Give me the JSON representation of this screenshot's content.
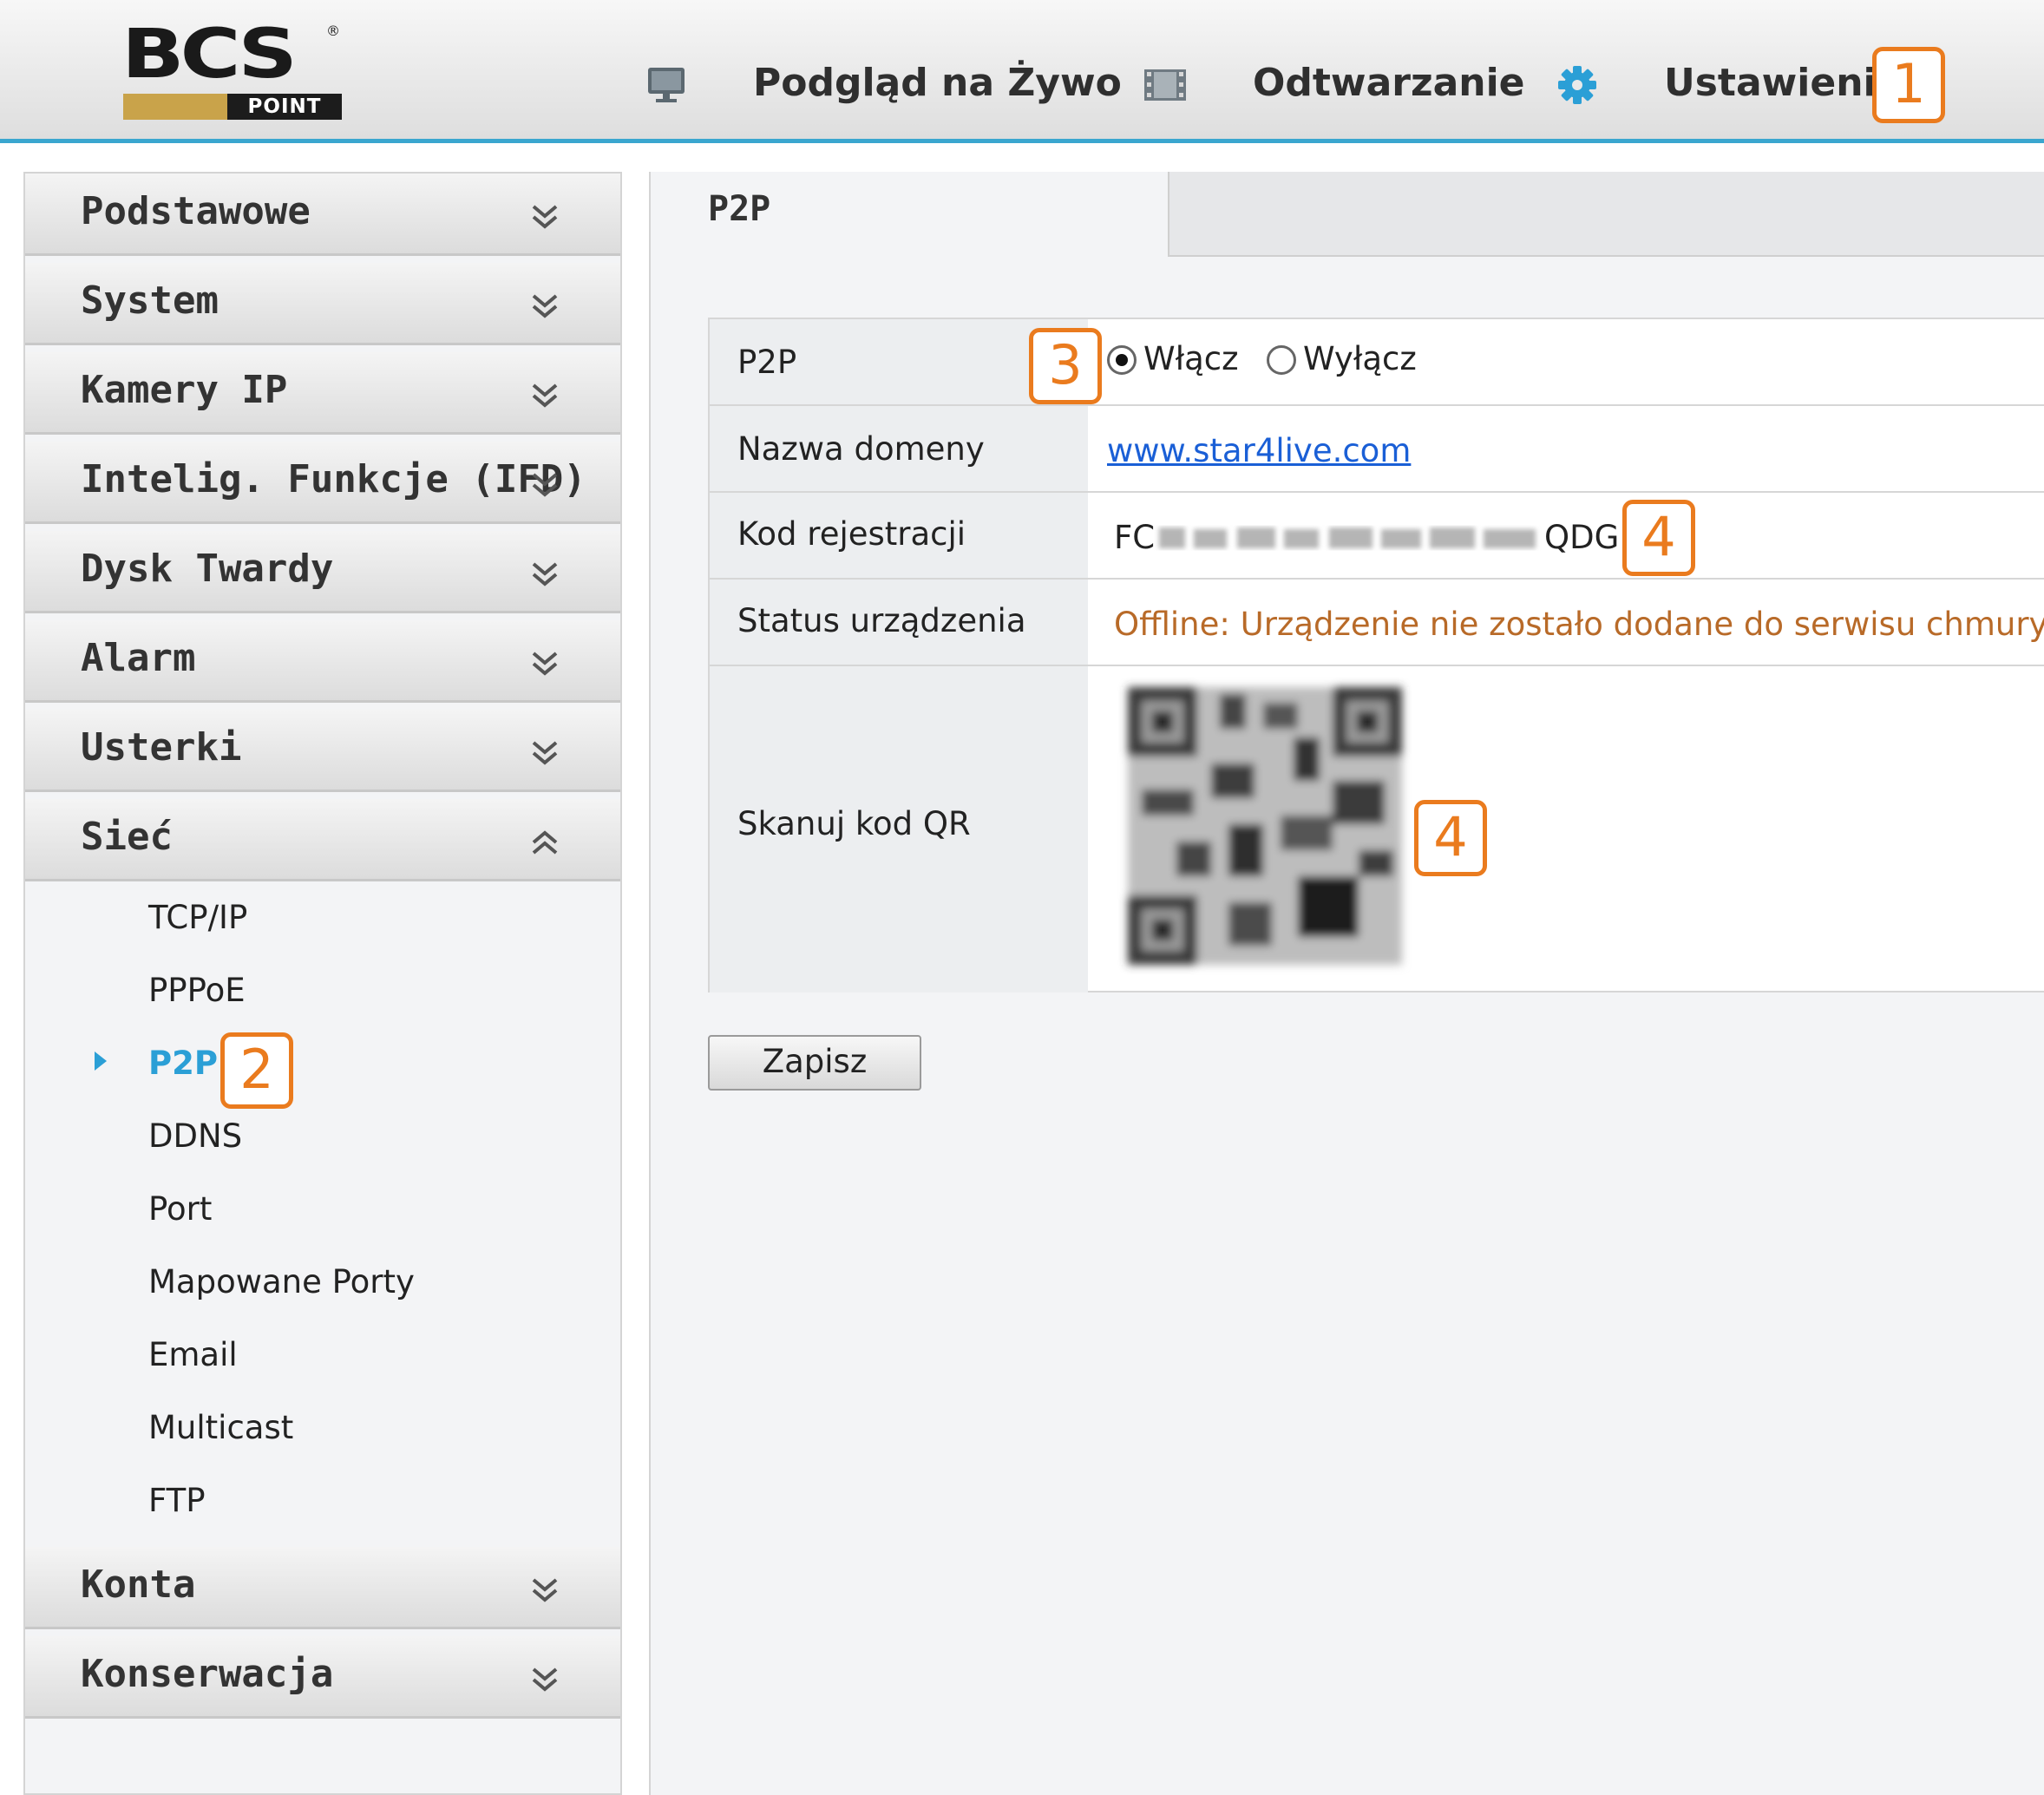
{
  "logo": {
    "brand": "BCS",
    "sub": "POINT",
    "reg": "®"
  },
  "header": {
    "nav": [
      {
        "label": "Podgląd na Żywo",
        "icon": "monitor-icon"
      },
      {
        "label": "Odtwarzanie",
        "icon": "film-icon"
      },
      {
        "label": "Ustawienia",
        "icon": "gear-icon"
      }
    ]
  },
  "badges": [
    "1",
    "2",
    "3",
    "4",
    "4"
  ],
  "sidebar": {
    "sections_top": [
      "Podstawowe",
      "System",
      "Kamery IP",
      "Intelig. Funkcje (IFD)",
      "Dysk Twardy",
      "Alarm",
      "Usterki",
      "Sieć"
    ],
    "sub_items": [
      "TCP/IP",
      "PPPoE",
      "P2P",
      "DDNS",
      "Port",
      "Mapowane Porty",
      "Email",
      "Multicast",
      "FTP"
    ],
    "active_sub_item": "P2P",
    "sections_bottom": [
      "Konta",
      "Konserwacja"
    ]
  },
  "content": {
    "tab": "P2P",
    "rows": {
      "p2p": {
        "label": "P2P",
        "on": "Włącz",
        "off": "Wyłącz",
        "selected": "Włącz"
      },
      "domain": {
        "label": "Nazwa domeny",
        "value": "www.star4live.com"
      },
      "code": {
        "label": "Kod rejestracji",
        "prefix": "FC",
        "suffix": "QDG"
      },
      "status": {
        "label": "Status urządzenia",
        "value": "Offline: Urządzenie nie zostało dodane do serwisu chmury. P"
      },
      "qr": {
        "label": "Skanuj kod QR"
      }
    },
    "save": "Zapisz"
  },
  "colors": {
    "accent": "#3aa6cf",
    "badge": "#ea7b1e",
    "active": "#2b9fd6",
    "link": "#1a5fd6",
    "status": "#b86a28"
  }
}
